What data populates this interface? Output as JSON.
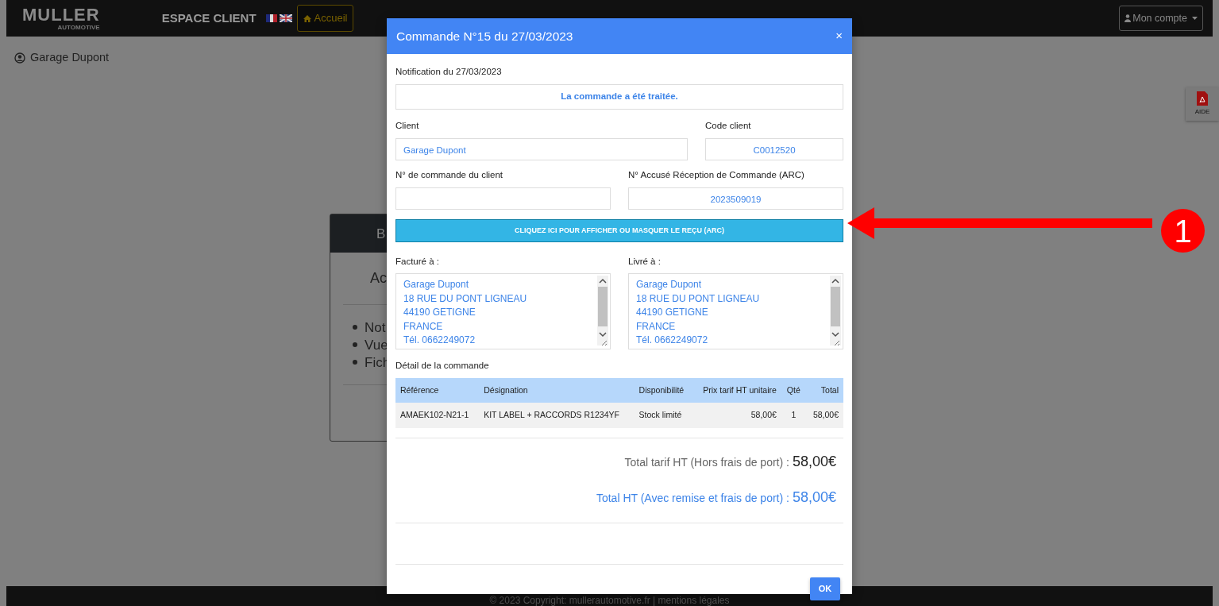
{
  "navbar": {
    "logo": {
      "name": "MULLER",
      "tagline": "AUTOMOTIVE"
    },
    "title": "ESPACE CLIENT",
    "home_button": "Accueil",
    "account_menu": "Mon compte"
  },
  "user": "Garage Dupont",
  "help_button": "AIDE",
  "background_card": {
    "header": "B",
    "heading": "Ac",
    "items": [
      "Not",
      "Vue",
      "Fich"
    ]
  },
  "modal": {
    "title": "Commande N°15 du 27/03/2023",
    "close": "×",
    "notification_label": "Notification du 27/03/2023",
    "notification_message": "La commande a été traitée.",
    "fields": [
      {
        "label": "Client",
        "value": "Garage Dupont"
      },
      {
        "label": "Code client",
        "value": "C0012520"
      },
      {
        "label": "N° de commande du client"
      },
      {
        "label": "N° Accusé Réception de Commande (ARC)",
        "value": "2023509019"
      }
    ],
    "toggle_button": "CLIQUEZ ICI POUR AFFICHER OU MASQUER LE REÇU (ARC)",
    "addresses": [
      {
        "label": "Facturé à :",
        "lines": [
          "Garage Dupont",
          "18 RUE DU PONT LIGNEAU",
          "44190 GETIGNE",
          "FRANCE",
          "Tél. 0662249072"
        ]
      },
      {
        "label": "Livré à :",
        "lines": [
          "Garage Dupont",
          "18 RUE DU PONT LIGNEAU",
          "44190 GETIGNE",
          "FRANCE",
          "Tél. 0662249072"
        ]
      }
    ],
    "details_title": "Détail de la commande",
    "table": {
      "columns": [
        "Référence",
        "Désignation",
        "Disponibilité",
        "Prix tarif HT unitaire",
        "Qté",
        "Total"
      ],
      "rows": [
        [
          "AMAEK102-N21-1",
          "KIT LABEL + RACCORDS R1234YF",
          "Stock limité",
          "58,00€",
          "1",
          "58,00€"
        ]
      ]
    },
    "totals": [
      {
        "kind": "plain",
        "label": "Total tarif HT (Hors frais de port) :",
        "value": "58,00€"
      },
      {
        "kind": "highlight",
        "label": "Total HT (Avec remise et frais de port) :",
        "value": "58,00€"
      }
    ],
    "ok_button": "OK"
  },
  "footer": "© 2023 Copyright: mullerautomotive.fr | mentions légales",
  "annotation": {
    "number": "1"
  }
}
